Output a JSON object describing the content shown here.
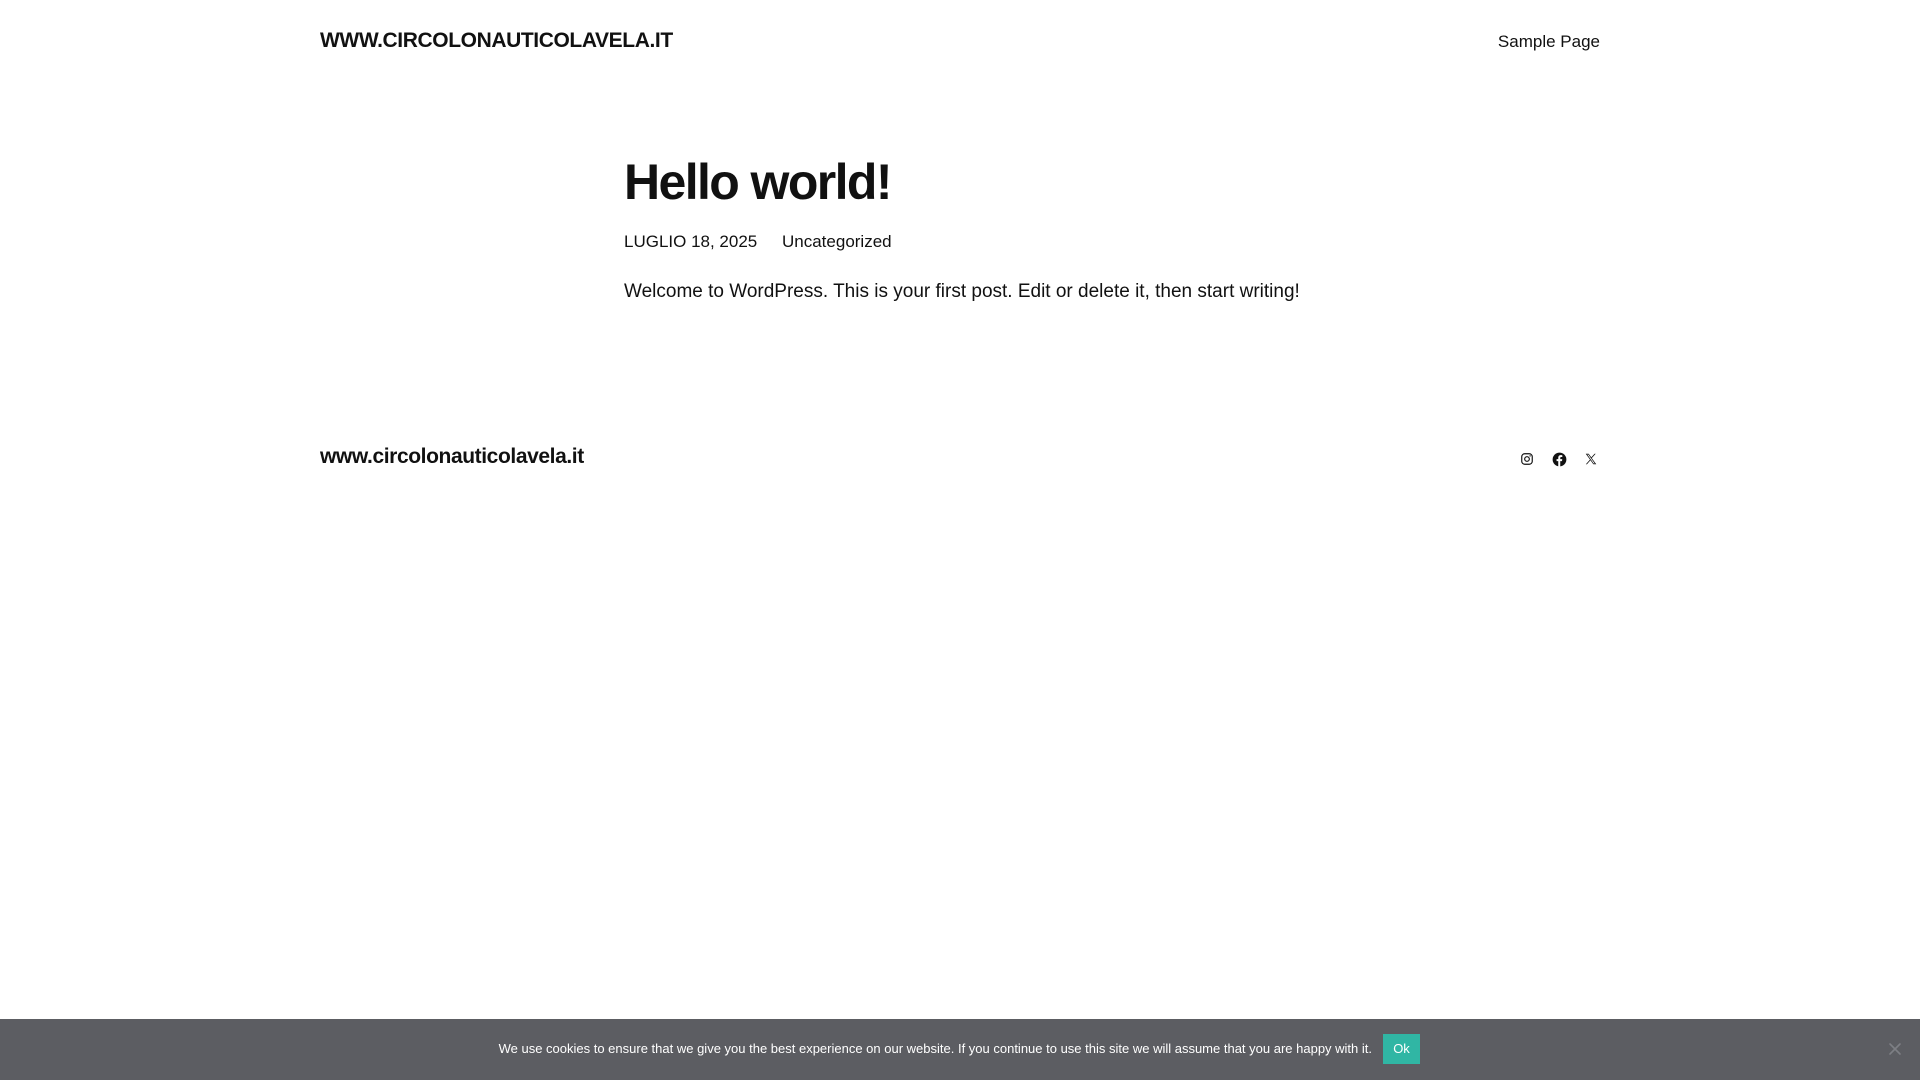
{
  "header": {
    "site_title": "WWW.CIRCOLONAUTICOLAVELA.IT",
    "nav_items": [
      "Sample Page"
    ]
  },
  "post": {
    "title": "Hello world!",
    "date": "LUGLIO 18, 2025",
    "category": "Uncategorized",
    "body": "Welcome to WordPress. This is your first post. Edit or delete it, then start writing!"
  },
  "footer": {
    "site_title": "www.circolonauticolavela.it",
    "social_icons": [
      "instagram-icon",
      "facebook-icon",
      "x-icon"
    ]
  },
  "cookie_notice": {
    "text": "We use cookies to ensure that we give you the best experience on our website. If you continue to use this site we will assume that you are happy with it.",
    "ok_label": "Ok",
    "close_icon": "close-icon"
  },
  "colors": {
    "text": "#111111",
    "background": "#ffffff",
    "cookie_bar": "#5c5d62",
    "cookie_ok": "#30b6a4"
  }
}
